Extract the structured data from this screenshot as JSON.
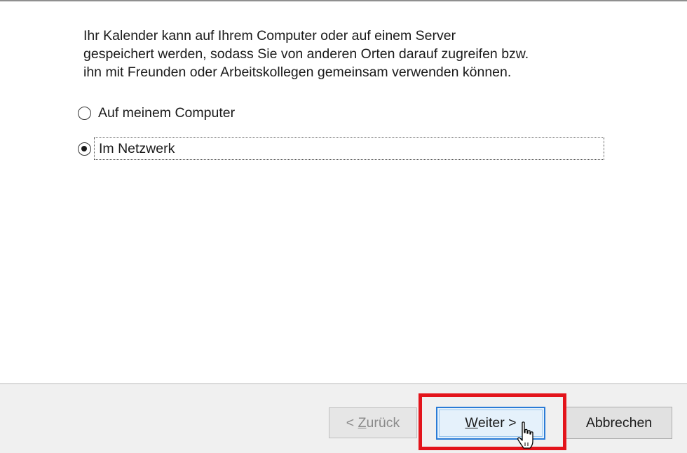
{
  "description": {
    "line1": "Ihr Kalender kann auf Ihrem Computer oder auf einem Server",
    "line2": "gespeichert werden, sodass Sie von anderen Orten darauf zugreifen bzw.",
    "line3": "ihn mit Freunden oder Arbeitskollegen gemeinsam verwenden können."
  },
  "options": [
    {
      "label": "Auf meinem Computer",
      "selected": false
    },
    {
      "label": "Im Netzwerk",
      "selected": true
    }
  ],
  "buttons": {
    "back": {
      "prefix": "< ",
      "underlined": "Z",
      "rest": "urück",
      "enabled": false
    },
    "next": {
      "underlined": "W",
      "rest": "eiter >",
      "enabled": true
    },
    "cancel": {
      "label": "Abbrechen",
      "enabled": true
    }
  },
  "colors": {
    "highlight": "#e3141b",
    "next_border": "#2a7bd6",
    "next_background": "#e5f1fb"
  },
  "icons": {
    "cursor": "hand-pointer-icon"
  }
}
